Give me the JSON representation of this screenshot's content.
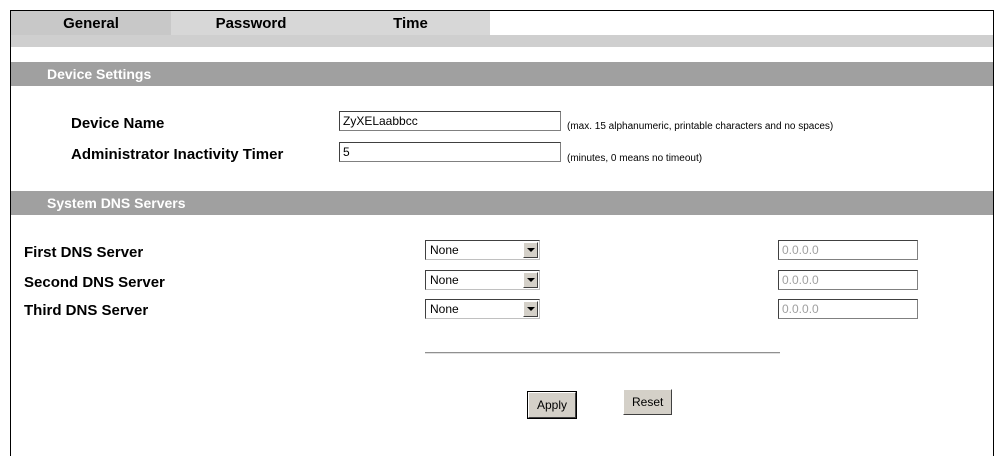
{
  "tabs": [
    {
      "label": "General",
      "active": true
    },
    {
      "label": "Password",
      "active": false
    },
    {
      "label": "Time",
      "active": false
    }
  ],
  "device_settings": {
    "title": "Device Settings",
    "device_name_label": "Device Name",
    "device_name_value": "ZyXELaabbcc",
    "device_name_hint": "(max. 15 alphanumeric, printable characters and no spaces)",
    "timer_label": "Administrator Inactivity Timer",
    "timer_value": "5",
    "timer_hint": "(minutes, 0 means no timeout)"
  },
  "dns": {
    "title": "System DNS Servers",
    "servers": [
      {
        "label": "First DNS Server",
        "type": "None",
        "ip": "0.0.0.0"
      },
      {
        "label": "Second DNS Server",
        "type": "None",
        "ip": "0.0.0.0"
      },
      {
        "label": "Third DNS Server",
        "type": "None",
        "ip": "0.0.0.0"
      }
    ]
  },
  "buttons": {
    "apply": "Apply",
    "reset": "Reset"
  }
}
